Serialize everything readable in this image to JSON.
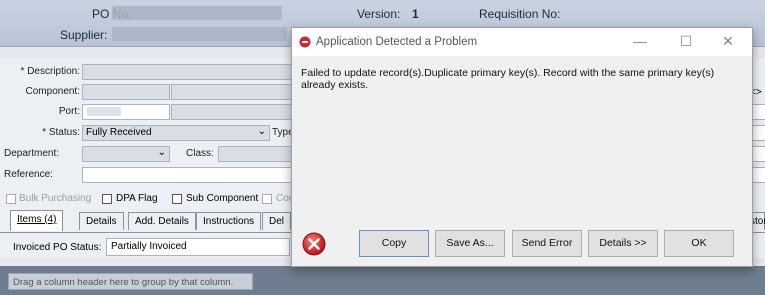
{
  "header": {
    "po_no_label": "PO No:",
    "supplier_label": "Supplier:",
    "version_label": "Version:",
    "version_value": "1",
    "requisition_label": "Requisition No:"
  },
  "form": {
    "description_label": "* Description:",
    "component_label": "Component:",
    "port_label": "Port:",
    "status_label": "* Status:",
    "status_value": "Fully Received",
    "type_label": "Type",
    "department_label": "Department:",
    "class_label": "Class:",
    "reference_label": "Reference:",
    "bulk_purchasing_label": "Bulk Purchasing",
    "dpa_flag_label": "DPA Flag",
    "sub_component_label": "Sub Component",
    "cor_label": "Cor",
    "invoiced_status_label": "Invoiced PO Status:",
    "invoiced_status_value": "Partially Invoiced",
    "right_edge_arrow": "<>",
    "right_edge_tab": "stor"
  },
  "tabs": [
    {
      "label": "Items (4)"
    },
    {
      "label": "Details"
    },
    {
      "label": "Add. Details"
    },
    {
      "label": "Instructions"
    },
    {
      "label": "Del"
    }
  ],
  "grid": {
    "group_hint": "Drag a column header here to group by that column."
  },
  "dialog": {
    "title": "Application Detected a Problem",
    "message": "Failed to update record(s).Duplicate primary key(s).  Record with the same primary key(s) already exists.",
    "buttons": {
      "copy": "Copy",
      "save_as": "Save As...",
      "send_error": "Send Error",
      "details": "Details >>",
      "ok": "OK"
    },
    "minimize_glyph": "—",
    "maximize_glyph": "☐",
    "close_glyph": "✕"
  },
  "colors": {
    "header_bg": "#c0cbdc",
    "error_red": "#d0262b",
    "group_bar": "#6f7d90"
  },
  "icons": [
    "error-icon",
    "chevron-down-icon",
    "minimize-icon",
    "maximize-icon",
    "close-icon"
  ]
}
